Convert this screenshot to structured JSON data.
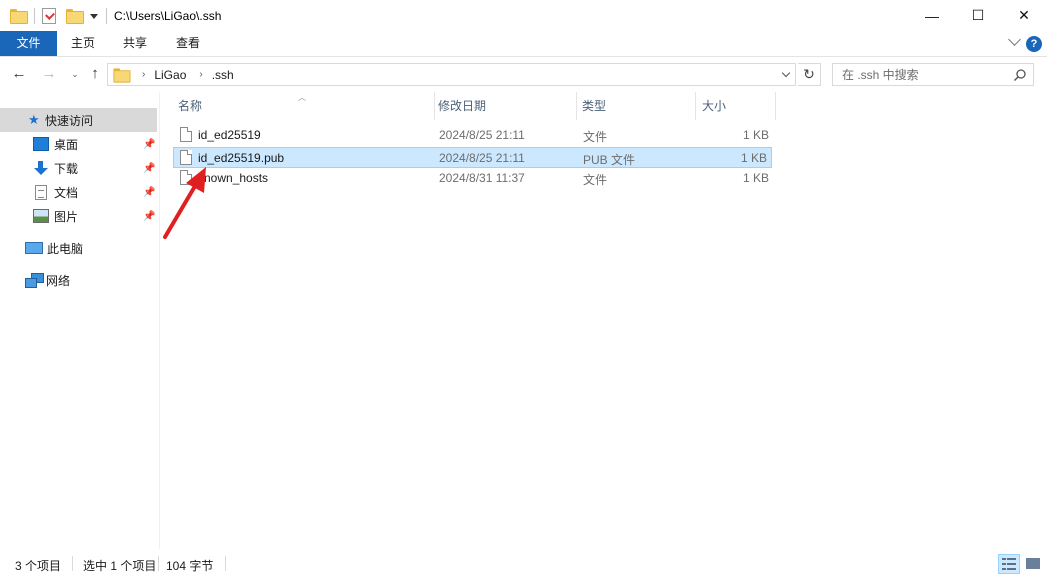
{
  "window": {
    "title_path": "C:\\Users\\LiGao\\.ssh",
    "minimize_glyph": "—",
    "maximize_glyph": "☐",
    "close_glyph": "✕"
  },
  "ribbon": {
    "tabs": [
      {
        "label": "文件"
      },
      {
        "label": "主页"
      },
      {
        "label": "共享"
      },
      {
        "label": "查看"
      }
    ],
    "help_glyph": "?"
  },
  "address": {
    "breadcrumbs": [
      "LiGao",
      ".ssh"
    ],
    "separator": "›",
    "refresh_glyph": "↻"
  },
  "search": {
    "placeholder": "在 .ssh 中搜索"
  },
  "sidebar": {
    "quick_access": "快速访问",
    "pinned": [
      {
        "label": "桌面",
        "icon": "desktop-icon"
      },
      {
        "label": "下载",
        "icon": "download-icon"
      },
      {
        "label": "文档",
        "icon": "document-icon"
      },
      {
        "label": "图片",
        "icon": "pictures-icon"
      }
    ],
    "this_pc": "此电脑",
    "network": "网络",
    "pin_glyph": "📌"
  },
  "columns": {
    "name": "名称",
    "modified": "修改日期",
    "type": "类型",
    "size": "大小"
  },
  "files": [
    {
      "name": "id_ed25519",
      "modified": "2024/8/25 21:11",
      "type": "文件",
      "size": "1 KB",
      "selected": false
    },
    {
      "name": "id_ed25519.pub",
      "modified": "2024/8/25 21:11",
      "type": "PUB 文件",
      "size": "1 KB",
      "selected": true
    },
    {
      "name": "known_hosts",
      "modified": "2024/8/31 11:37",
      "type": "文件",
      "size": "1 KB",
      "selected": false
    }
  ],
  "status": {
    "item_count": "3 个项目",
    "selected": "选中 1 个项目",
    "selected_size": "104 字节"
  },
  "colors": {
    "accent": "#1a66b8",
    "selection_bg": "#cce8ff",
    "selection_border": "#99d1ff",
    "annotation_arrow": "#e02020"
  }
}
